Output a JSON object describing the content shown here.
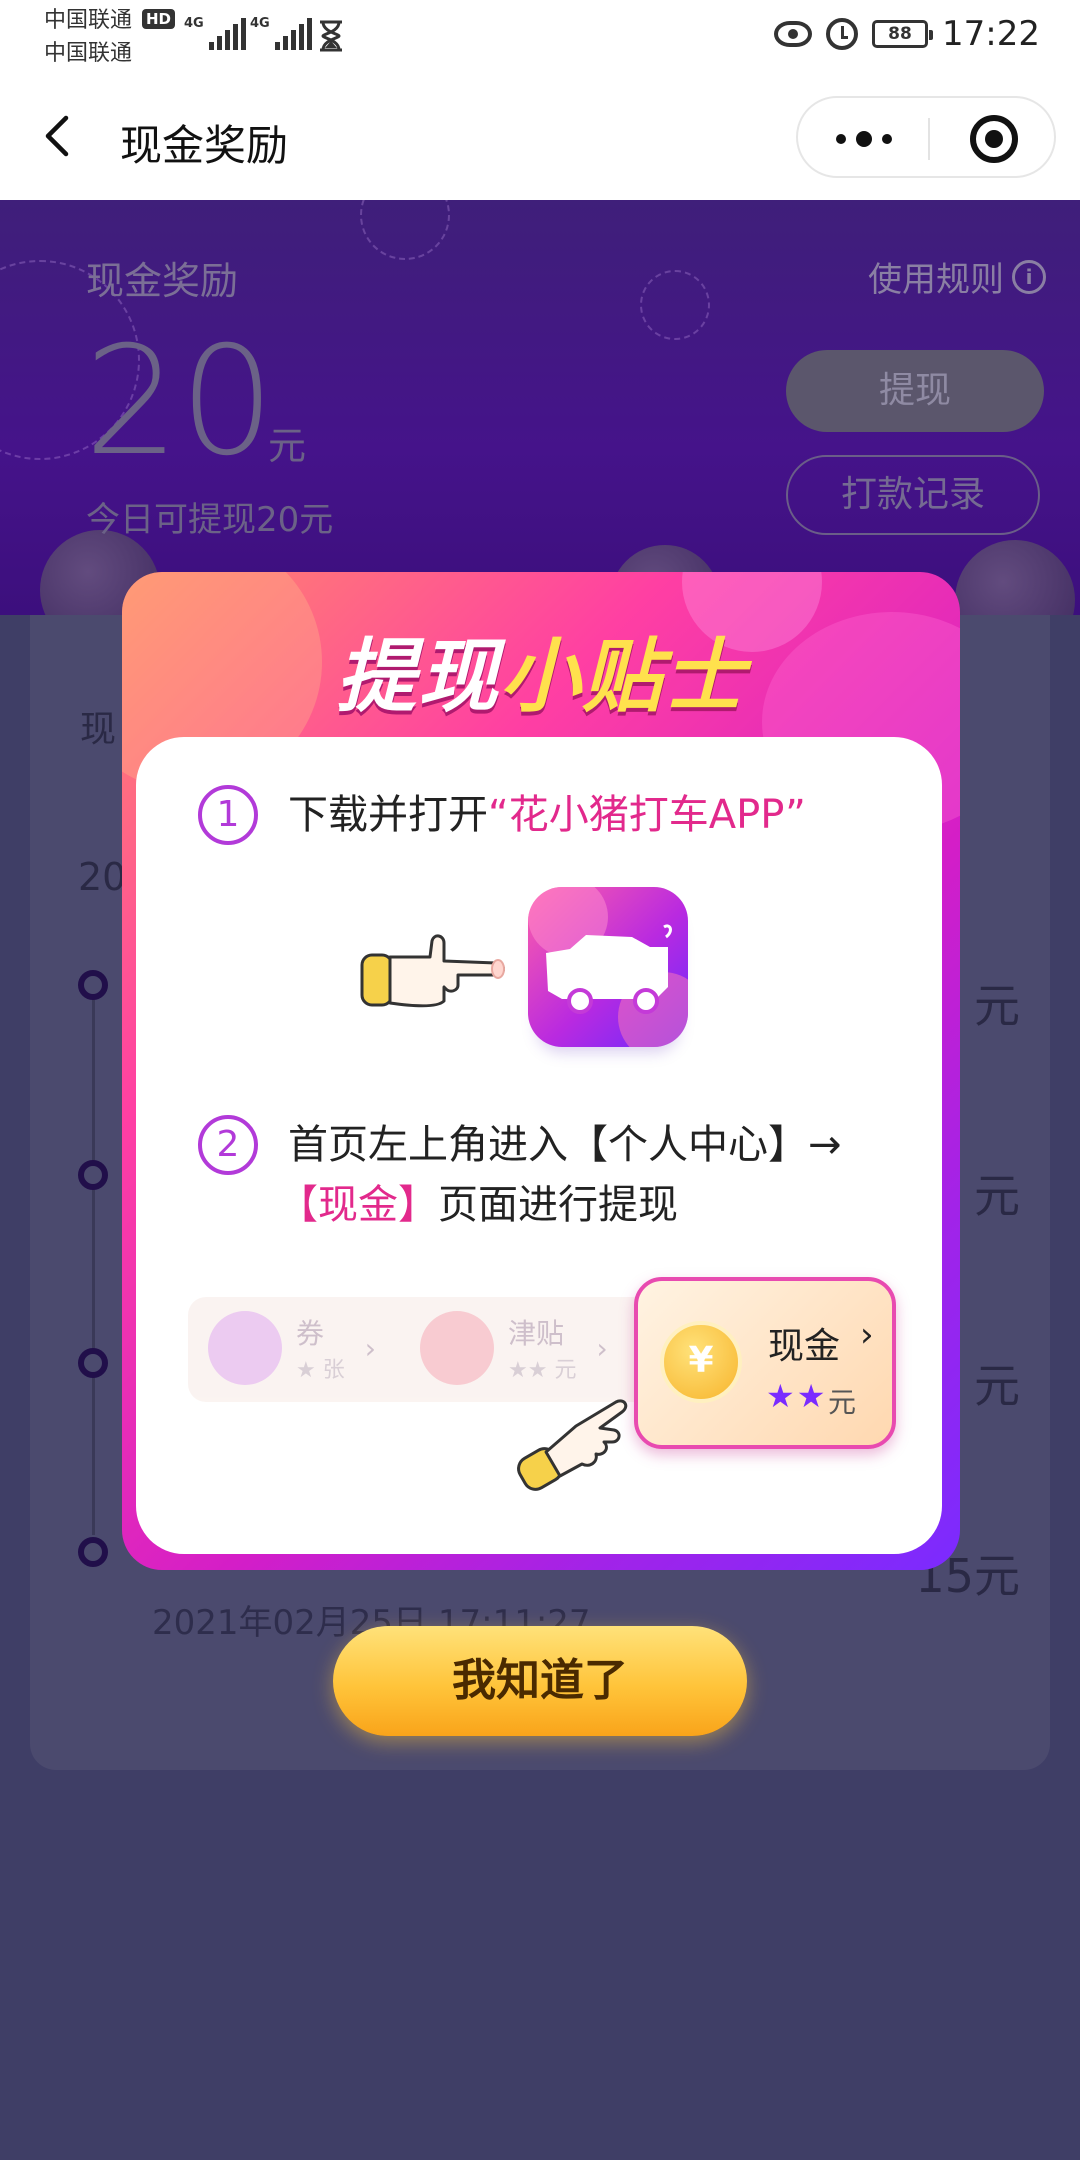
{
  "status_bar": {
    "carrier1": "中国联通",
    "carrier2": "中国联通",
    "hd": "HD",
    "net1": "4G",
    "net2": "4G",
    "battery": "88",
    "time": "17:22"
  },
  "nav": {
    "title": "现金奖励"
  },
  "hero": {
    "label": "现金奖励",
    "rules_link": "使用规则",
    "amount": "20",
    "unit": "元",
    "today": "今日可提现20元",
    "withdraw_button": "提现",
    "records_button": "打款记录"
  },
  "card": {
    "tab": "现",
    "year": "20",
    "values": [
      "元",
      "元",
      "元",
      "15元"
    ],
    "date": "2021年02月25日 17:11:27"
  },
  "modal": {
    "title_part1": "提现",
    "title_part2": "小贴士",
    "step1_num": "1",
    "step1_text": "下载并打开",
    "step1_highlight": "“花小猪打车APP”",
    "step2_num": "2",
    "step2_line1": "首页左上角进入【个人中心】→",
    "step2_highlight": "【现金】",
    "step2_line2_rest": "页面进行提现",
    "faded_items": [
      {
        "label": "券",
        "sub": "★ 张"
      },
      {
        "label": "津贴",
        "sub": "★★ 元"
      }
    ],
    "cash_label": "现金",
    "cash_stars": "★★",
    "cash_unit": "元",
    "ok_button": "我知道了"
  },
  "colors": {
    "accent_pink": "#e2298c",
    "accent_purple": "#7a2bff",
    "button_yellow": "#ffc43a"
  }
}
